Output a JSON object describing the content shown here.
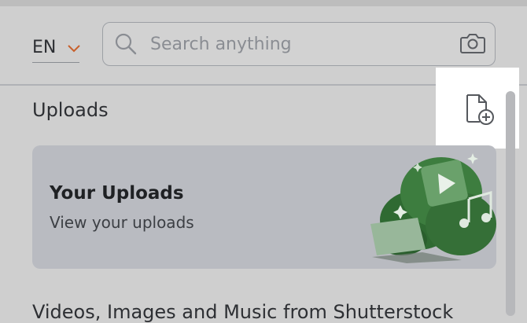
{
  "header": {
    "language": "EN",
    "search_placeholder": "Search anything"
  },
  "uploads": {
    "section_title": "Uploads",
    "card_title": "Your Uploads",
    "card_subtitle": "View your uploads"
  },
  "library": {
    "section_title": "Videos, Images and Music from Shutterstock"
  },
  "icons": {
    "language_dropdown": "chevron-down-icon",
    "search": "search-icon",
    "camera": "camera-icon",
    "upload": "file-add-icon"
  },
  "colors": {
    "accent": "#c8602c",
    "art_green": "#2f6a32"
  }
}
